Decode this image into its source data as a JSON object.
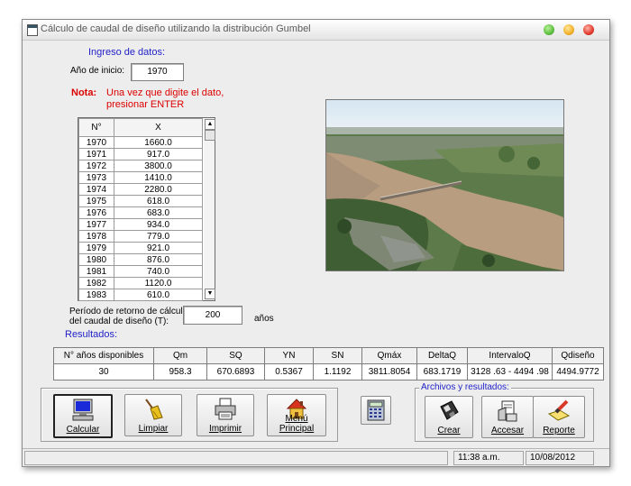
{
  "window": {
    "title": "Cálculo de caudal de diseño utilizando la distribución Gumbel",
    "colors": {
      "close": "#e23b2e",
      "minimize": "#f2b128",
      "maximize": "#5dbf3f",
      "label_blue": "#1f1fc8",
      "note_red": "#dd0000"
    }
  },
  "input": {
    "section_title": "Ingreso de datos:",
    "start_year_label": "Año de inicio:",
    "start_year_value": "1970",
    "note_label": "Nota:",
    "note_line1": "Una vez que digite el dato,",
    "note_line2": "presionar ENTER"
  },
  "grid": {
    "col_n": "N°",
    "col_x": "X",
    "rows": [
      {
        "n": "1970",
        "x": "1660.0"
      },
      {
        "n": "1971",
        "x": "917.0"
      },
      {
        "n": "1972",
        "x": "3800.0"
      },
      {
        "n": "1973",
        "x": "1410.0"
      },
      {
        "n": "1974",
        "x": "2280.0"
      },
      {
        "n": "1975",
        "x": "618.0"
      },
      {
        "n": "1976",
        "x": "683.0"
      },
      {
        "n": "1977",
        "x": "934.0"
      },
      {
        "n": "1978",
        "x": "779.0"
      },
      {
        "n": "1979",
        "x": "921.0"
      },
      {
        "n": "1980",
        "x": "876.0"
      },
      {
        "n": "1981",
        "x": "740.0"
      },
      {
        "n": "1982",
        "x": "1120.0"
      },
      {
        "n": "1983",
        "x": "610.0"
      }
    ]
  },
  "return_period": {
    "label_line1": "Período de retorno de cálculo",
    "label_line2": "del caudal de diseño (T):",
    "value": "200",
    "unit": "años"
  },
  "results": {
    "section_title": "Resultados:",
    "headers": [
      "N° años disponibles",
      "Qm",
      "SQ",
      "YN",
      "SN",
      "Qmáx",
      "DeltaQ",
      "IntervaloQ",
      "Qdiseño"
    ],
    "values": [
      "30",
      "958.3",
      "670.6893",
      "0.5367",
      "1.1192",
      "3811.8054",
      "683.1719",
      "3128 .63 -  4494 .98",
      "4494.9772"
    ]
  },
  "buttons": {
    "calcular": "Calcular",
    "limpiar": "Limpiar",
    "imprimir": "Imprimir",
    "menu": "Menú Principal",
    "files_group": "Archivos y resultados:",
    "crear": "Crear",
    "accesar": "Accesar",
    "reporte": "Reporte"
  },
  "status": {
    "time": "11:38 a.m.",
    "date": "10/08/2012"
  }
}
